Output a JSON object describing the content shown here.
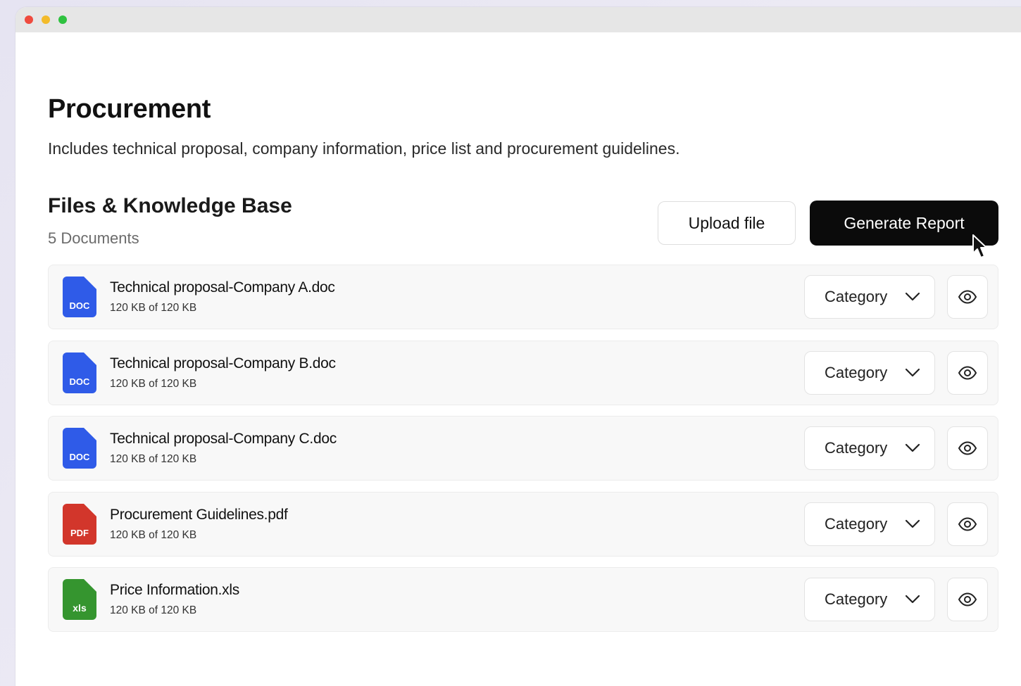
{
  "page": {
    "title": "Procurement",
    "description": "Includes technical proposal, company information, price list and procurement guidelines."
  },
  "files_section": {
    "title": "Files & Knowledge Base",
    "count_label": "5 Documents",
    "upload_label": "Upload file",
    "generate_label": "Generate Report"
  },
  "files": [
    {
      "name": "Technical proposal-Company A.doc",
      "size": "120 KB of 120 KB",
      "type_label": "DOC",
      "icon": "doc-file-icon",
      "color": "#2f5be8",
      "category": "Category"
    },
    {
      "name": "Technical proposal-Company B.doc",
      "size": "120 KB of 120 KB",
      "type_label": "DOC",
      "icon": "doc-file-icon",
      "color": "#2f5be8",
      "category": "Category"
    },
    {
      "name": "Technical proposal-Company C.doc",
      "size": "120 KB of 120 KB",
      "type_label": "DOC",
      "icon": "doc-file-icon",
      "color": "#2f5be8",
      "category": "Category"
    },
    {
      "name": "Procurement Guidelines.pdf",
      "size": "120 KB of 120 KB",
      "type_label": "PDF",
      "icon": "pdf-file-icon",
      "color": "#d2362b",
      "category": "Category"
    },
    {
      "name": "Price Information.xls",
      "size": "120 KB of 120 KB",
      "type_label": "xls",
      "icon": "xls-file-icon",
      "color": "#35952f",
      "category": "Category"
    }
  ],
  "colors": {
    "doc": "#2f5be8",
    "pdf": "#d2362b",
    "xls": "#35952f",
    "primary_button": "#0b0b0b"
  }
}
